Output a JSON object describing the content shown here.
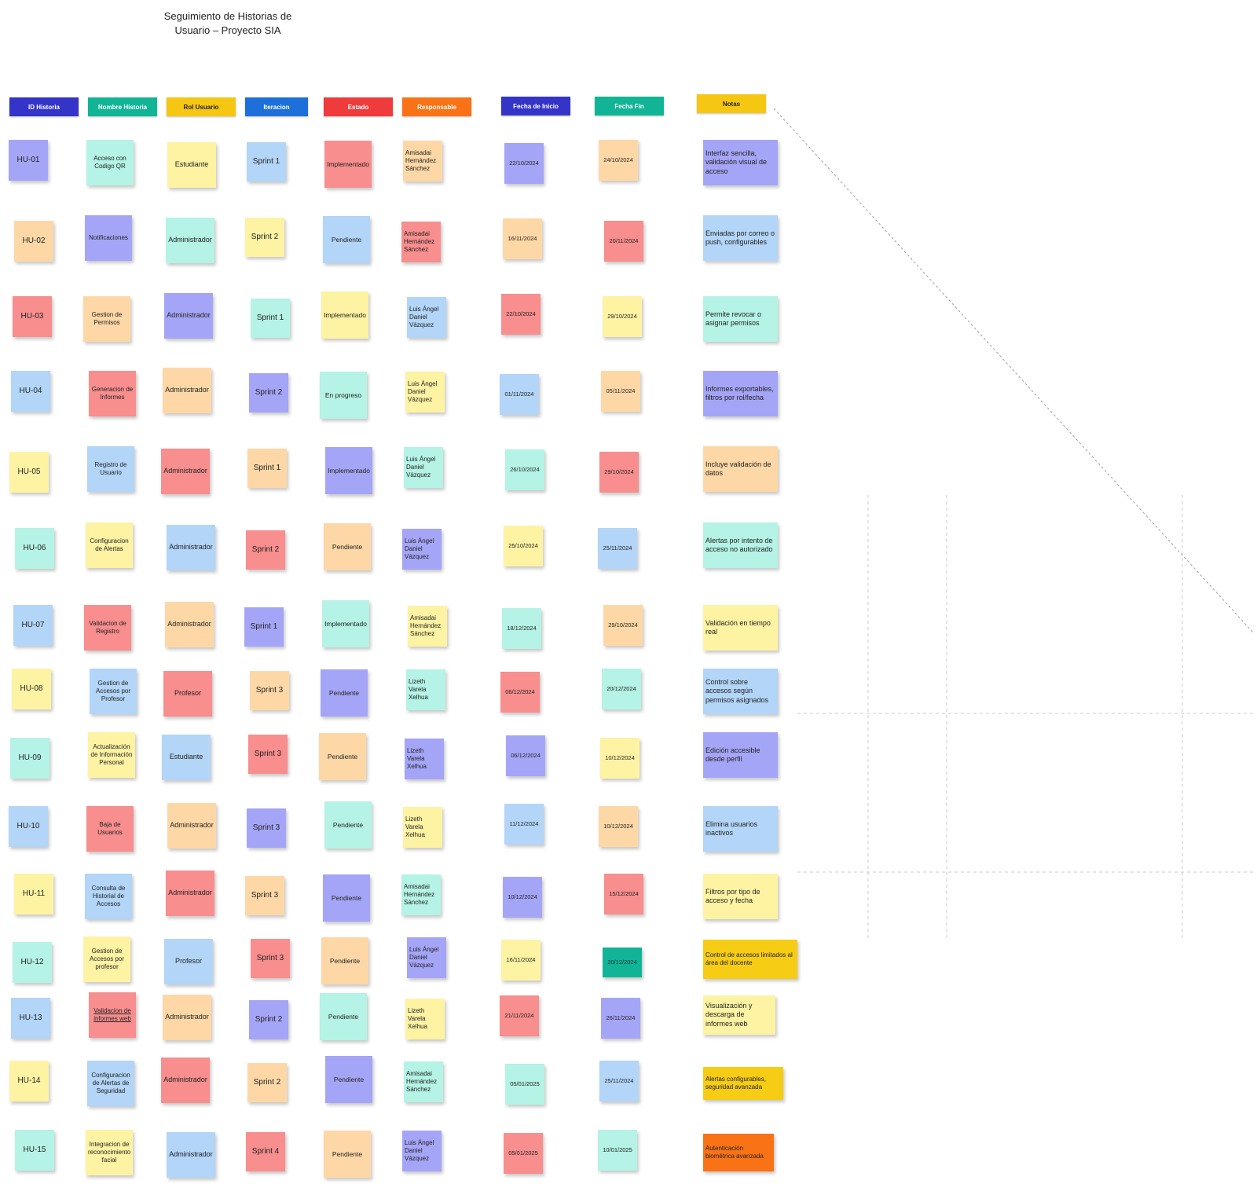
{
  "title": "Seguimiento de Historias de Usuario – Proyecto SIA",
  "colors": {
    "purple": "#a5a5f7",
    "teal": "#b4f3e5",
    "yellow": "#fdf3a3",
    "blue": "#b2d5f8",
    "red": "#f88e8e",
    "orange": "#fdd8a6",
    "navy": "#3838c9",
    "green": "#12b497",
    "amber": "#f6cc14",
    "bright_orange": "#f97316"
  },
  "headers": [
    {
      "label": "ID Historia",
      "color": "#3534c9"
    },
    {
      "label": "Nombre Historia",
      "color": "#11b596"
    },
    {
      "label": "Rol Usuario",
      "color": "#f6c712"
    },
    {
      "label": "Iteracion",
      "color": "#1d6fd9"
    },
    {
      "label": "Estado",
      "color": "#ef3b3b"
    },
    {
      "label": "Responsable",
      "color": "#f97316"
    },
    {
      "label": "Fecha de Inicio",
      "color": "#3534c9"
    },
    {
      "label": "Fecha Fin",
      "color": "#11b596"
    },
    {
      "label": "Notas",
      "color": "#f6c712"
    }
  ],
  "rows": [
    {
      "cells": [
        {
          "text": "HU-01",
          "color": "purple"
        },
        {
          "text": "Acceso con Codigo QR",
          "color": "teal"
        },
        {
          "text": "Estudiante",
          "color": "yellow"
        },
        {
          "text": "Sprint 1",
          "color": "blue"
        },
        {
          "text": "Implementado",
          "color": "red"
        },
        {
          "text": "Amisadai Hernández Sánchez",
          "color": "orange"
        },
        {
          "text": "22/10/2024",
          "color": "purple"
        },
        {
          "text": "24/10/2024",
          "color": "orange"
        },
        {
          "text": "Interfaz sencilla, validación visual de acceso",
          "color": "purple"
        }
      ]
    },
    {
      "cells": [
        {
          "text": "HU-02",
          "color": "orange"
        },
        {
          "text": "Notificaciones",
          "color": "purple"
        },
        {
          "text": "Administrador",
          "color": "teal"
        },
        {
          "text": "Sprint 2",
          "color": "yellow"
        },
        {
          "text": "Pendiente",
          "color": "blue"
        },
        {
          "text": "Amisadai Hernández Sánchez",
          "color": "red"
        },
        {
          "text": "16/11/2024",
          "color": "orange"
        },
        {
          "text": "20/11/2024",
          "color": "red"
        },
        {
          "text": "Enviadas por correo o push, configurables",
          "color": "blue"
        }
      ]
    },
    {
      "cells": [
        {
          "text": "HU-03",
          "color": "red"
        },
        {
          "text": "Gestion de Permisos",
          "color": "orange"
        },
        {
          "text": "Administrador",
          "color": "purple"
        },
        {
          "text": "Sprint 1",
          "color": "teal"
        },
        {
          "text": "Implementado",
          "color": "yellow"
        },
        {
          "text": "Luis Ángel Daniel Vázquez",
          "color": "blue"
        },
        {
          "text": "22/10/2024",
          "color": "red"
        },
        {
          "text": "29/10/2024",
          "color": "yellow"
        },
        {
          "text": "Permite revocar o asignar permisos",
          "color": "teal"
        }
      ]
    },
    {
      "cells": [
        {
          "text": "HU-04",
          "color": "blue"
        },
        {
          "text": "Generacion de Informes",
          "color": "red"
        },
        {
          "text": "Administrador",
          "color": "orange"
        },
        {
          "text": "Sprint 2",
          "color": "purple"
        },
        {
          "text": "En progreso",
          "color": "teal"
        },
        {
          "text": "Luis Ángel Daniel Vázquez",
          "color": "yellow"
        },
        {
          "text": "01/11/2024",
          "color": "blue"
        },
        {
          "text": "05/11/2024",
          "color": "orange"
        },
        {
          "text": "Informes exportables, filtros por rol/fecha",
          "color": "purple"
        }
      ]
    },
    {
      "cells": [
        {
          "text": "HU-05",
          "color": "yellow"
        },
        {
          "text": "Registro de Usuario",
          "color": "blue"
        },
        {
          "text": "Administrador",
          "color": "red"
        },
        {
          "text": "Sprint 1",
          "color": "orange"
        },
        {
          "text": "Implementado",
          "color": "purple"
        },
        {
          "text": "Luis Ángel Daniel Vázquez",
          "color": "teal"
        },
        {
          "text": "26/10/2024",
          "color": "teal"
        },
        {
          "text": "29/10/2024",
          "color": "red"
        },
        {
          "text": "Incluye validación de datos",
          "color": "orange"
        }
      ]
    },
    {
      "cells": [
        {
          "text": "HU-06",
          "color": "teal"
        },
        {
          "text": "Configuracion de Alertas",
          "color": "yellow"
        },
        {
          "text": "Administrador",
          "color": "blue"
        },
        {
          "text": "Sprint 2",
          "color": "red"
        },
        {
          "text": "Pendiente",
          "color": "orange"
        },
        {
          "text": "Luis Ángel Daniel Vázquez",
          "color": "purple"
        },
        {
          "text": "25/10/2024",
          "color": "yellow"
        },
        {
          "text": "25/11/2024",
          "color": "blue"
        },
        {
          "text": "Alertas por intento de acceso no autorizado",
          "color": "teal"
        }
      ]
    },
    {
      "cells": [
        {
          "text": "HU-07",
          "color": "blue"
        },
        {
          "text": "Validacion de Registro",
          "color": "red"
        },
        {
          "text": "Administrador",
          "color": "orange"
        },
        {
          "text": "Sprint 1",
          "color": "purple"
        },
        {
          "text": "Implementado",
          "color": "teal"
        },
        {
          "text": "Amisadai Hernández Sánchez",
          "color": "yellow"
        },
        {
          "text": "18/12/2024",
          "color": "teal"
        },
        {
          "text": "29/10/2024",
          "color": "orange"
        },
        {
          "text": "Validación en tiempo real",
          "color": "yellow"
        }
      ]
    },
    {
      "cells": [
        {
          "text": "HU-08",
          "color": "yellow"
        },
        {
          "text": "Gestion de Accesos por Profesor",
          "color": "blue"
        },
        {
          "text": "Profesor",
          "color": "red"
        },
        {
          "text": "Sprint 3",
          "color": "orange"
        },
        {
          "text": "Pendiente",
          "color": "purple"
        },
        {
          "text": "Lizeth Varela Xelhua",
          "color": "teal"
        },
        {
          "text": "06/12/2024",
          "color": "red"
        },
        {
          "text": "20/12/2024",
          "color": "teal"
        },
        {
          "text": "Control sobre accesos según permisos asignados",
          "color": "blue"
        }
      ]
    },
    {
      "cells": [
        {
          "text": "HU-09",
          "color": "teal"
        },
        {
          "text": "Actualización de Información Personal",
          "color": "yellow"
        },
        {
          "text": "Estudiante",
          "color": "blue"
        },
        {
          "text": "Sprint 3",
          "color": "red"
        },
        {
          "text": "Pendiente",
          "color": "orange"
        },
        {
          "text": "Lizeth Varela Xelhua",
          "color": "purple"
        },
        {
          "text": "06/12/2024",
          "color": "purple"
        },
        {
          "text": "10/12/2024",
          "color": "yellow"
        },
        {
          "text": "Edición accesible desde perfil",
          "color": "purple"
        }
      ]
    },
    {
      "cells": [
        {
          "text": "HU-10",
          "color": "blue"
        },
        {
          "text": "Baja de Usuarios",
          "color": "red"
        },
        {
          "text": "Administrador",
          "color": "orange"
        },
        {
          "text": "Sprint 3",
          "color": "purple"
        },
        {
          "text": "Pendiente",
          "color": "teal"
        },
        {
          "text": "Lizeth Varela Xelhua",
          "color": "yellow"
        },
        {
          "text": "11/12/2024",
          "color": "blue"
        },
        {
          "text": "10/12/2024",
          "color": "orange"
        },
        {
          "text": "Elimina usuarios inactivos",
          "color": "blue"
        }
      ]
    },
    {
      "cells": [
        {
          "text": "HU-11",
          "color": "yellow"
        },
        {
          "text": "Consulta de Historial de Accesos",
          "color": "blue"
        },
        {
          "text": "Administrador",
          "color": "red"
        },
        {
          "text": "Sprint 3",
          "color": "orange"
        },
        {
          "text": "Pendiente",
          "color": "purple"
        },
        {
          "text": "Amisadai Hernández Sánchez",
          "color": "teal"
        },
        {
          "text": "10/12/2024",
          "color": "purple"
        },
        {
          "text": "15/12/2024",
          "color": "red"
        },
        {
          "text": "Filtros por tipo de acceso y fecha",
          "color": "yellow"
        }
      ]
    },
    {
      "cells": [
        {
          "text": "HU-12",
          "color": "teal"
        },
        {
          "text": "Gestion de Accesos por profesor",
          "color": "yellow"
        },
        {
          "text": "Profesor",
          "color": "blue"
        },
        {
          "text": "Sprint 3",
          "color": "red"
        },
        {
          "text": "Pendiente",
          "color": "orange"
        },
        {
          "text": "Luis Ángel Daniel Vázquez",
          "color": "purple"
        },
        {
          "text": "16/11/2024",
          "color": "yellow"
        },
        {
          "text": "20/12/2024",
          "color": "green"
        },
        {
          "text": "Control de accesos limitados al área del docente",
          "color": "amber"
        }
      ]
    },
    {
      "cells": [
        {
          "text": "HU-13",
          "color": "blue"
        },
        {
          "text": "Validacion de informes web",
          "color": "red"
        },
        {
          "text": "Administrador",
          "color": "orange"
        },
        {
          "text": "Sprint 2",
          "color": "purple"
        },
        {
          "text": "Pendiente",
          "color": "teal"
        },
        {
          "text": "Lizeth Varela Xelhua",
          "color": "yellow"
        },
        {
          "text": "21/11/2024",
          "color": "red"
        },
        {
          "text": "26/11/2024",
          "color": "purple"
        },
        {
          "text": "Visualización y descarga de informes web",
          "color": "yellow"
        }
      ]
    },
    {
      "cells": [
        {
          "text": "HU-14",
          "color": "yellow"
        },
        {
          "text": "Configuracion de Alertas de Seguridad",
          "color": "blue"
        },
        {
          "text": "Administrador",
          "color": "red"
        },
        {
          "text": "Sprint 2",
          "color": "orange"
        },
        {
          "text": "Pendiente",
          "color": "purple"
        },
        {
          "text": "Amisadai Hernández Sánchez",
          "color": "teal"
        },
        {
          "text": "05/01/2025",
          "color": "teal"
        },
        {
          "text": "25/11/2024",
          "color": "blue"
        },
        {
          "text": "Alertas configurables, seguridad avanzada",
          "color": "amber"
        }
      ]
    },
    {
      "cells": [
        {
          "text": "HU-15",
          "color": "teal"
        },
        {
          "text": "Integracion de reconocimiento facial",
          "color": "yellow"
        },
        {
          "text": "Administrador",
          "color": "blue"
        },
        {
          "text": "Sprint 4",
          "color": "red"
        },
        {
          "text": "Pendiente",
          "color": "orange"
        },
        {
          "text": "Luis Ángel Daniel Vázquez",
          "color": "purple"
        },
        {
          "text": "05/01/2025",
          "color": "red"
        },
        {
          "text": "10/01/2025",
          "color": "teal"
        },
        {
          "text": "Autenticación biométrica avanzada",
          "color": "bright_orange"
        }
      ]
    }
  ]
}
